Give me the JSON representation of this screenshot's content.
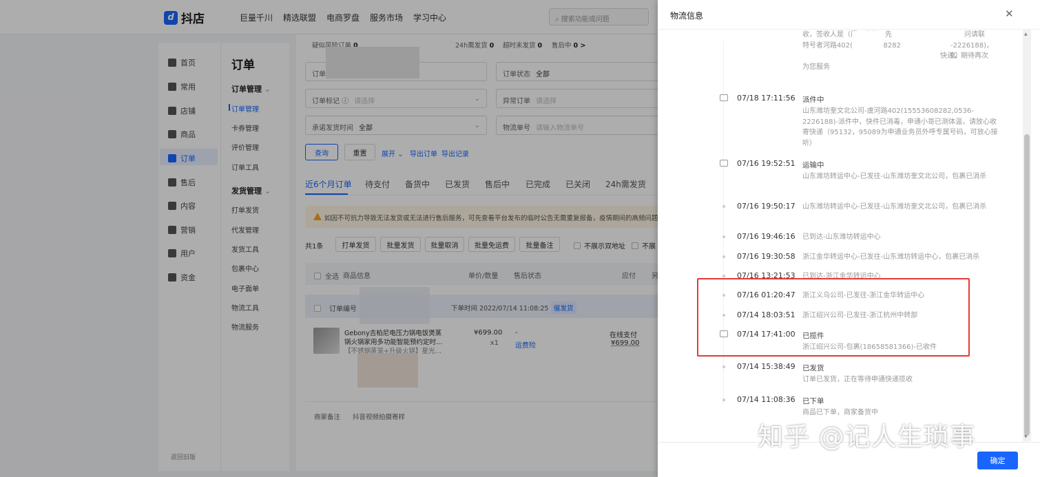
{
  "topbar": {
    "logo": "抖店",
    "nav": [
      "巨量千川",
      "精选联盟",
      "电商罗盘",
      "服务市场",
      "学习中心"
    ],
    "search_placeholder": "搜索功能或问题"
  },
  "sidebar": {
    "items": [
      "首页",
      "常用",
      "店铺",
      "商品",
      "订单",
      "售后",
      "内容",
      "营销",
      "用户",
      "资金"
    ],
    "footer": "返回旧版"
  },
  "subnav": {
    "group1": "订单管理",
    "items1": [
      "订单管理",
      "卡券管理",
      "评价管理",
      "订单工具"
    ],
    "group2": "发货管理",
    "items2": [
      "打单发货",
      "代发管理",
      "发货工具",
      "包裹中心",
      "电子面单",
      "物流工具",
      "物流服务"
    ]
  },
  "main": {
    "title": "订单",
    "stats": {
      "risk_label": "疑似风险订单",
      "risk": "0",
      "h24_label": "24h需发货",
      "h24": "0",
      "timeout_label": "超时未发货",
      "timeout": "0",
      "after_label": "售后中",
      "after": "0 >"
    },
    "filters": {
      "order": "订单",
      "status_label": "订单状态",
      "status": "全部",
      "mark_label": "订单标记 ⓘ",
      "mark_ph": "请选择",
      "abnormal_label": "异常订单",
      "abnormal_ph": "请选择",
      "promise_label": "承诺发货时间",
      "promise": "全部",
      "logistics_label": "物流单号",
      "logistics_ph": "请输入物流单号"
    },
    "buttons": {
      "query": "查询",
      "reset": "重置",
      "expand": "展开 ⌄",
      "export": "导出订单",
      "export_log": "导出记录"
    },
    "tabs": [
      "近6个月订单",
      "待支付",
      "备货中",
      "已发货",
      "售后中",
      "已完成",
      "已关闭",
      "24h需发货"
    ],
    "notice": "如因不可抗力导致无法发货或无法进行售后服务，可先查看平台发布的临时公告无需重复报备，疫情期间的高频问题",
    "toolbar": {
      "count": "共1条",
      "buttons": [
        "打单发货",
        "批量发货",
        "批量取消",
        "批量免运费",
        "批量备注"
      ],
      "opt1": "不展示双地址",
      "opt2": "不展"
    },
    "table": {
      "select_all": "全选",
      "col_product": "商品信息",
      "col_price": "单价/数量",
      "col_after": "售后状态",
      "col_pay": "应付",
      "col_more": "另"
    },
    "order": {
      "no_label": "订单编号",
      "time": "下单时间 2022/07/14 11:08:25",
      "badge": "催发货",
      "product_line1": "Gebony吉柏尼电压力锅电饭煲蒸",
      "product_line2": "锅火锅家用多功能智能预约定时…",
      "product_line3": "【不锈钢蒸笼+升级火锅】星光…",
      "price": "¥699.00",
      "qty": "x1",
      "after": "-",
      "insurance": "运费险",
      "pay_label": "在线支付",
      "pay": "¥699.00"
    },
    "footer": {
      "remark": "商家备注",
      "video": "抖音视频拍摄寄样"
    }
  },
  "panel": {
    "title": "物流信息",
    "confirm": "确定",
    "top_fragment": [
      "收，签收人是（门卫代签）先",
      "特号者河路402(15553608282",
      "快递，期待再次",
      "为您服务"
    ],
    "top_fragment_right": [
      "问请联",
      "-2226188)，如"
    ],
    "events": [
      {
        "time": "07/18 17:11:56",
        "status": "派件中",
        "detail": "山东潍坊奎文北公司-虞河路402(15553608282,0536-2226188)-派件中，快件已消毒，申通小哥已测体温，请放心收寄快递（95132，95089为申通业务员外呼专属号码，可放心接听）"
      },
      {
        "time": "07/16 19:52:51",
        "status": "运输中",
        "detail": "山东潍坊转运中心-已发往-山东潍坊奎文北公司，包裹已消杀"
      },
      {
        "time": "07/16 19:50:17",
        "status": "",
        "detail": "山东潍坊转运中心-已发往-山东潍坊奎文北公司，包裹已消杀"
      },
      {
        "time": "07/16 19:46:16",
        "status": "已到达-山东潍坊转运中心",
        "detail": ""
      },
      {
        "time": "07/16 19:30:58",
        "status": "浙江金华转运中心-已发往-山东潍坊转运中心，包裹已消杀",
        "detail": ""
      },
      {
        "time": "07/16 13:21:53",
        "status": "已到达-浙江金华转运中心",
        "detail": ""
      },
      {
        "time": "07/16 01:20:47",
        "status": "浙江义乌公司-已发往-浙江金华转运中心",
        "detail": ""
      },
      {
        "time": "07/14 18:03:51",
        "status": "浙江绍兴公司-已发往-浙江杭州中转部",
        "detail": ""
      },
      {
        "time": "07/14 17:41:00",
        "status": "已揽件",
        "detail": "浙江绍兴公司-包裹(18658581366)-已收件"
      },
      {
        "time": "07/14 15:38:49",
        "status": "已发货",
        "detail": "订单已发货，正在等待申通快递揽收"
      },
      {
        "time": "07/14 11:08:36",
        "status": "已下单",
        "detail": "商品已下单，商家备货中"
      }
    ]
  },
  "watermark": "知乎 @记人生琐事",
  "colors": {
    "accent": "#1966ff",
    "highlight": "#e53935",
    "notice_bg": "#fff6e5"
  }
}
